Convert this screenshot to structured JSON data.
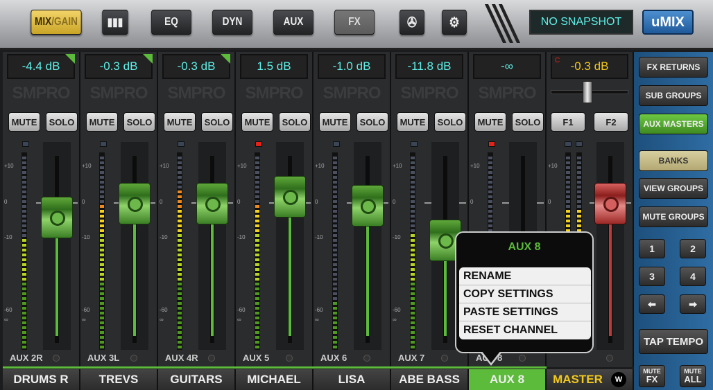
{
  "toolbar": {
    "mix_label": "MIX",
    "gain_label": "/GAIN",
    "meters_icon": "meter-bars-icon",
    "tabs": [
      "EQ",
      "DYN",
      "AUX",
      "FX"
    ],
    "snapshot_icon": "film-reel-icon",
    "settings_icon": "gear-icon",
    "snapshot": "NO SNAPSHOT",
    "brand": "uMIX"
  },
  "channels": [
    {
      "db": "-4.4 dB",
      "fader_db": -4.4,
      "meter": 0.58,
      "clip": false,
      "flag": true,
      "sub": "AUX 2R",
      "name": "DRUMS R"
    },
    {
      "db": "-0.3 dB",
      "fader_db": -0.3,
      "meter": 0.75,
      "clip": false,
      "flag": true,
      "sub": "AUX 3L",
      "name": "TREVS"
    },
    {
      "db": "-0.3 dB",
      "fader_db": -0.3,
      "meter": 0.82,
      "clip": false,
      "flag": true,
      "sub": "AUX 4R",
      "name": "GUITARS"
    },
    {
      "db": "1.5 dB",
      "fader_db": 1.5,
      "meter": 0.74,
      "clip": true,
      "flag": false,
      "sub": "AUX 5",
      "name": "MICHAEL"
    },
    {
      "db": "-1.0 dB",
      "fader_db": -1.0,
      "meter": 0.25,
      "clip": false,
      "flag": false,
      "sub": "AUX 6",
      "name": "LISA"
    },
    {
      "db": "-11.8 dB",
      "fader_db": -11.8,
      "meter": 0.6,
      "clip": false,
      "flag": false,
      "sub": "AUX 7",
      "name": "ABE BASS"
    },
    {
      "db": "-∞",
      "fader_db": -60,
      "meter": 0.0,
      "clip": true,
      "flag": false,
      "sub": "AUX 8",
      "name": "AUX 8"
    }
  ],
  "mute_label": "MUTE",
  "solo_label": "SOLO",
  "logo": "SMPRO",
  "scale": [
    "+10",
    "0",
    "-10",
    "-60",
    "∞"
  ],
  "master": {
    "db": "-0.3 dB",
    "clip_indicator": "C",
    "f1": "F1",
    "f2": "F2",
    "name": "MASTER",
    "fader_db": -0.3,
    "meter": 0.72,
    "waves_icon": "waves-logo-icon"
  },
  "popup": {
    "title": "AUX 8",
    "items": [
      "RENAME",
      "COPY SETTINGS",
      "PASTE SETTINGS",
      "RESET CHANNEL"
    ]
  },
  "right_panel": {
    "buttons": [
      "FX RETURNS",
      "SUB GROUPS",
      "AUX MASTERS",
      "BANKS",
      "VIEW GROUPS",
      "MUTE GROUPS"
    ],
    "numbers": [
      "1",
      "2",
      "3",
      "4"
    ],
    "tap_tempo": "TAP TEMPO",
    "mute_fx": [
      "MUTE",
      "FX"
    ],
    "mute_all": [
      "MUTE",
      "ALL"
    ]
  },
  "colors": {
    "accent_green": "#5cbb3a",
    "display_cyan": "#5ff0e8",
    "master_yellow": "#f2c81c",
    "panel_blue": "#2f6da3"
  }
}
